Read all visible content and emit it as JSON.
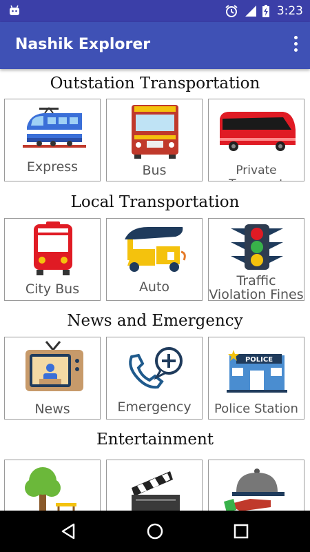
{
  "status_bar": {
    "time": "3:23",
    "icons": [
      "android-notification-icon",
      "alarm-icon",
      "signal-icon",
      "battery-charging-icon"
    ]
  },
  "app_bar": {
    "title": "Nashik Explorer",
    "menu_icon": "more-vert-icon"
  },
  "sections": [
    {
      "title": "Outstation Transportation",
      "tiles": [
        {
          "label": "Express",
          "icon": "train-icon"
        },
        {
          "label": "Bus",
          "icon": "bus-icon"
        },
        {
          "label": "Private Transport",
          "icon": "coach-bus-icon"
        }
      ]
    },
    {
      "title": "Local Transportation",
      "tiles": [
        {
          "label": "City Bus",
          "icon": "city-bus-icon"
        },
        {
          "label": "Auto",
          "icon": "auto-rickshaw-icon"
        },
        {
          "label_line1": "Traffic",
          "label_line2": "Violation Fines",
          "icon": "traffic-light-icon"
        }
      ]
    },
    {
      "title": "News and Emergency",
      "tiles": [
        {
          "label": "News",
          "icon": "tv-news-icon"
        },
        {
          "label": "Emergency",
          "icon": "phone-plus-icon"
        },
        {
          "label": "Police Station",
          "icon": "police-station-icon"
        }
      ]
    },
    {
      "title": "Entertainment",
      "tiles": [
        {
          "label": "",
          "icon": "tree-icon"
        },
        {
          "label": "",
          "icon": "clapperboard-icon"
        },
        {
          "label": "",
          "icon": "food-cloche-icon"
        }
      ]
    }
  ],
  "nav_bar": {
    "icons": [
      "back-icon",
      "home-icon",
      "recents-icon"
    ]
  },
  "colors": {
    "status_bar": "#3b3fa8",
    "app_bar": "#3f51b5",
    "tile_border": "#9a9a9a"
  }
}
